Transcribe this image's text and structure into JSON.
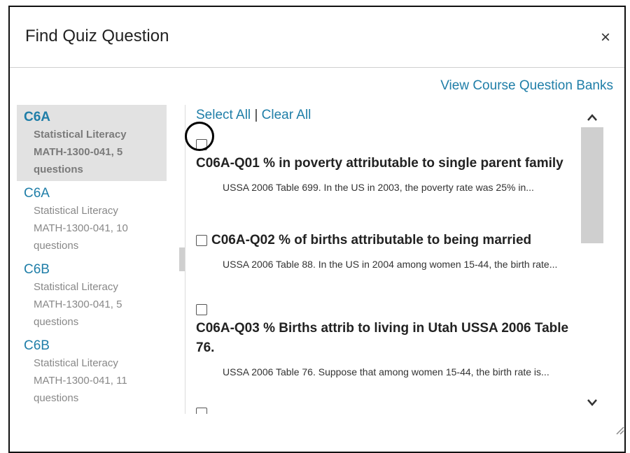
{
  "dialog": {
    "title": "Find Quiz Question",
    "close_label": "×",
    "banks_link": "View Course Question Banks"
  },
  "banks": [
    {
      "name": "C6A",
      "desc": [
        "Statistical Literacy",
        "MATH-1300-041, 5",
        "questions"
      ],
      "selected": true
    },
    {
      "name": "C6A",
      "desc": [
        "Statistical Literacy",
        "MATH-1300-041, 10",
        "questions"
      ],
      "selected": false
    },
    {
      "name": "C6B",
      "desc": [
        "Statistical Literacy",
        "MATH-1300-041, 5",
        "questions"
      ],
      "selected": false
    },
    {
      "name": "C6B",
      "desc": [
        "Statistical Literacy",
        "MATH-1300-041, 11",
        "questions"
      ],
      "selected": false
    }
  ],
  "selection": {
    "select_all": "Select All",
    "separator": "|",
    "clear_all": "Clear All"
  },
  "questions": [
    {
      "title": "C06A-Q01 % in poverty attributable to single parent family",
      "desc": "USSA 2006 Table 699. In the US in 2003, the poverty rate was 25% in..."
    },
    {
      "title": "C06A-Q02 % of births attributable to being married",
      "desc": "USSA 2006 Table 88. In the US in 2004 among women 15-44, the birth rate..."
    },
    {
      "title": "C06A-Q03 % Births attrib to living in Utah USSA 2006 Table 76.",
      "desc": "USSA 2006 Table 76. Suppose that among women 15-44, the birth rate is..."
    }
  ],
  "scroll": {
    "up": "^",
    "down": "⌄"
  }
}
